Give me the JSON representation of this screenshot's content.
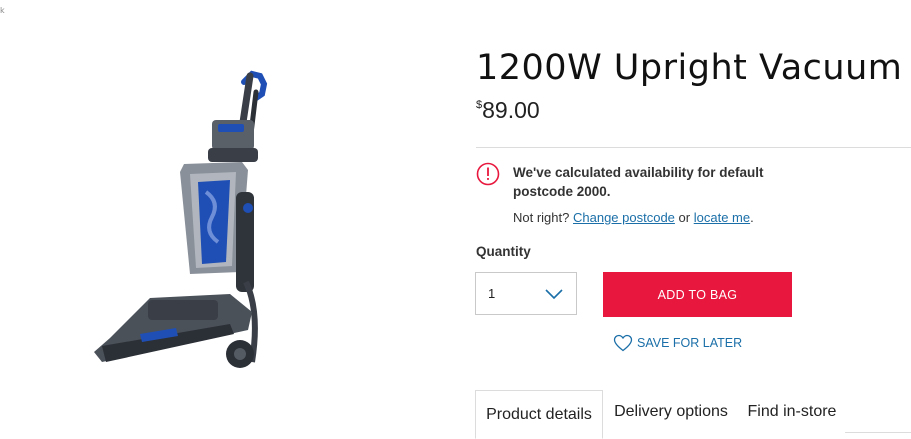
{
  "corner_mark": "k",
  "product": {
    "image_label": "",
    "title": "1200W Upright Vacuum",
    "price_currency": "$",
    "price_amount": "89.00"
  },
  "availability": {
    "message": "We've calculated availability for default postcode 2000.",
    "prompt": "Not right?",
    "change_postcode_label": "Change postcode",
    "or_text": "or",
    "locate_me_label": "locate me",
    "end_period": "."
  },
  "quantity": {
    "label": "Quantity",
    "value": "1"
  },
  "actions": {
    "add_to_bag_label": "ADD TO BAG",
    "save_for_later_label": "SAVE FOR LATER"
  },
  "tabs": [
    {
      "label": "Product details",
      "active": true
    },
    {
      "label": "Delivery options",
      "active": false
    },
    {
      "label": "Find in-store",
      "active": false
    }
  ],
  "colors": {
    "accent": "#e8173d",
    "link": "#1b6fa8",
    "product_blue": "#1f4fb5"
  }
}
